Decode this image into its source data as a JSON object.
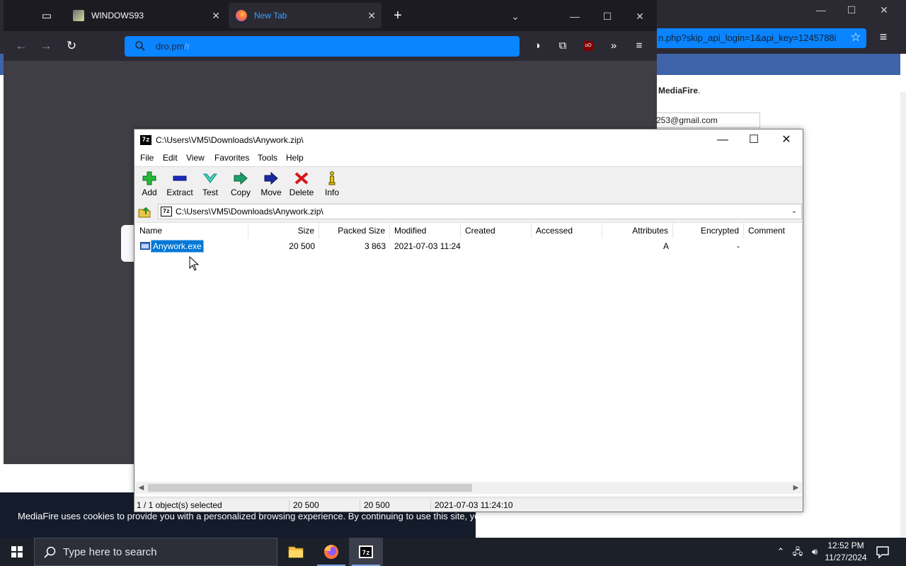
{
  "bg_browser": {
    "url_fragment": "n.php?skip_api_login=1&api_key=1245788i",
    "mediafire_text_bold": "MediaFire",
    "mediafire_text_rest": ".",
    "email_value": "253@gmail.com",
    "cookie_text": "MediaFire uses cookies to provide you with a personalized browsing experience. By continuing to use this site, yo"
  },
  "firefox": {
    "tabs": [
      {
        "label": "WINDOWS93"
      },
      {
        "label": "New Tab"
      }
    ],
    "url": {
      "host": "dro.pm",
      "path": "/r"
    }
  },
  "sevenzip": {
    "title": "C:\\Users\\VM5\\Downloads\\Anywork.zip\\",
    "menu": [
      "File",
      "Edit",
      "View",
      "Favorites",
      "Tools",
      "Help"
    ],
    "toolbar": [
      "Add",
      "Extract",
      "Test",
      "Copy",
      "Move",
      "Delete",
      "Info"
    ],
    "address": "C:\\Users\\VM5\\Downloads\\Anywork.zip\\",
    "columns": [
      "Name",
      "Size",
      "Packed Size",
      "Modified",
      "Created",
      "Accessed",
      "Attributes",
      "Encrypted",
      "Comment"
    ],
    "rows": [
      {
        "name": "Anywork.exe",
        "size": "20 500",
        "packed_size": "3 863",
        "modified": "2021-07-03 11:24",
        "created": "",
        "accessed": "",
        "attributes": "A",
        "encrypted": "-",
        "comment": ""
      }
    ],
    "status": {
      "selection": "1 / 1 object(s) selected",
      "size": "20 500",
      "packed": "20 500",
      "modified": "2021-07-03 11:24:10"
    }
  },
  "taskbar": {
    "search_placeholder": "Type here to search",
    "time": "12:52 PM",
    "date": "11/27/2024"
  },
  "colors": {
    "firefox_url_bg": "#0a84ff",
    "selection": "#0078d7",
    "mediafire_blue": "#3f63a8"
  }
}
